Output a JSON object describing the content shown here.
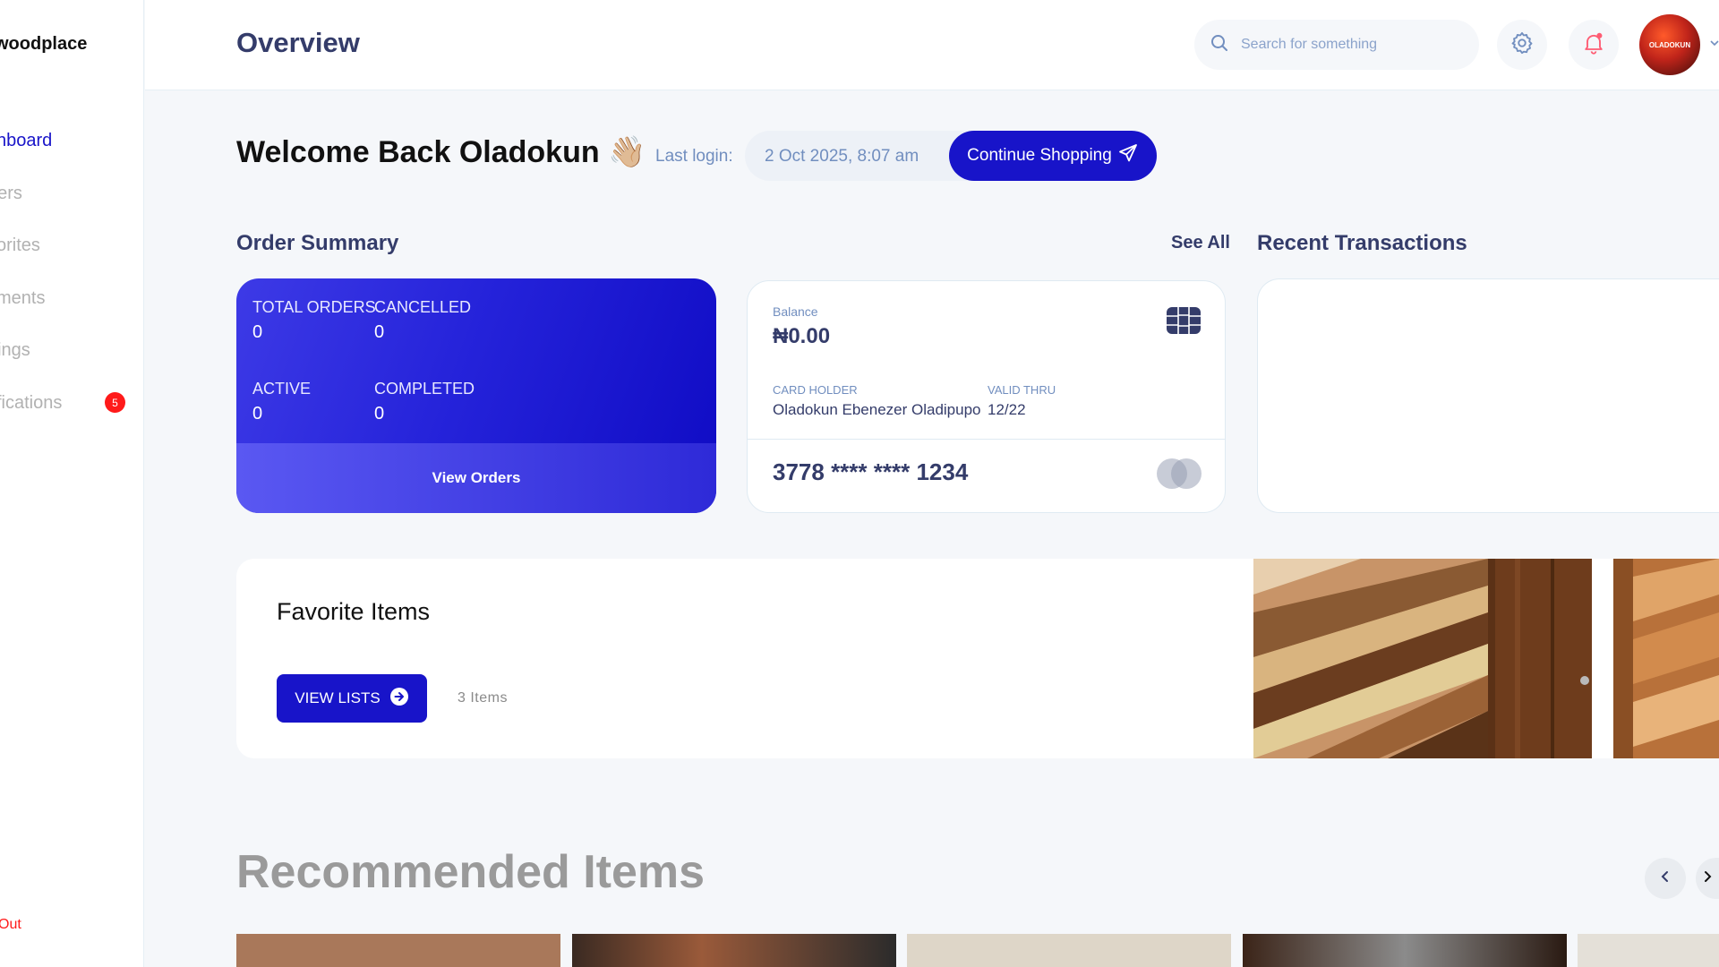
{
  "sidebar": {
    "brand": "woodplace",
    "items": [
      {
        "label": "shboard",
        "active": true
      },
      {
        "label": "ders"
      },
      {
        "label": "vorites"
      },
      {
        "label": "yments"
      },
      {
        "label": "ttings"
      },
      {
        "label": "tifications",
        "badge": "5"
      }
    ],
    "logout": "Out"
  },
  "header": {
    "title": "Overview",
    "search_placeholder": "Search for something",
    "avatar_text": "OLADOKUN"
  },
  "welcome": {
    "greeting": "Welcome Back Oladokun 👋🏼",
    "last_login_label": "Last login:",
    "last_login_value": "2 Oct 2025, 8:07 am",
    "continue_label": "Continue Shopping"
  },
  "order_summary": {
    "title": "Order Summary",
    "see_all": "See All",
    "stats": [
      {
        "label": "TOTAL ORDERS",
        "value": "0"
      },
      {
        "label": "CANCELLED",
        "value": "0"
      },
      {
        "label": "ACTIVE",
        "value": "0"
      },
      {
        "label": "COMPLETED",
        "value": "0"
      }
    ],
    "footer": "View Orders"
  },
  "card": {
    "balance_label": "Balance",
    "balance": "₦0.00",
    "holder_label": "CARD HOLDER",
    "holder": "Oladokun Ebenezer Oladipupo",
    "valid_label": "VALID THRU",
    "valid": "12/22",
    "number": "3778 **** **** 1234"
  },
  "transactions": {
    "title": "Recent Transactions"
  },
  "favorites": {
    "title": "Favorite Items",
    "button": "VIEW LISTS",
    "count": "3 Items"
  },
  "recommended": {
    "title": "Recommended Items"
  },
  "colors": {
    "accent": "#1814c9",
    "text_primary": "#343c6a",
    "text_secondary": "#718ebf",
    "danger": "#ff1a1a"
  }
}
